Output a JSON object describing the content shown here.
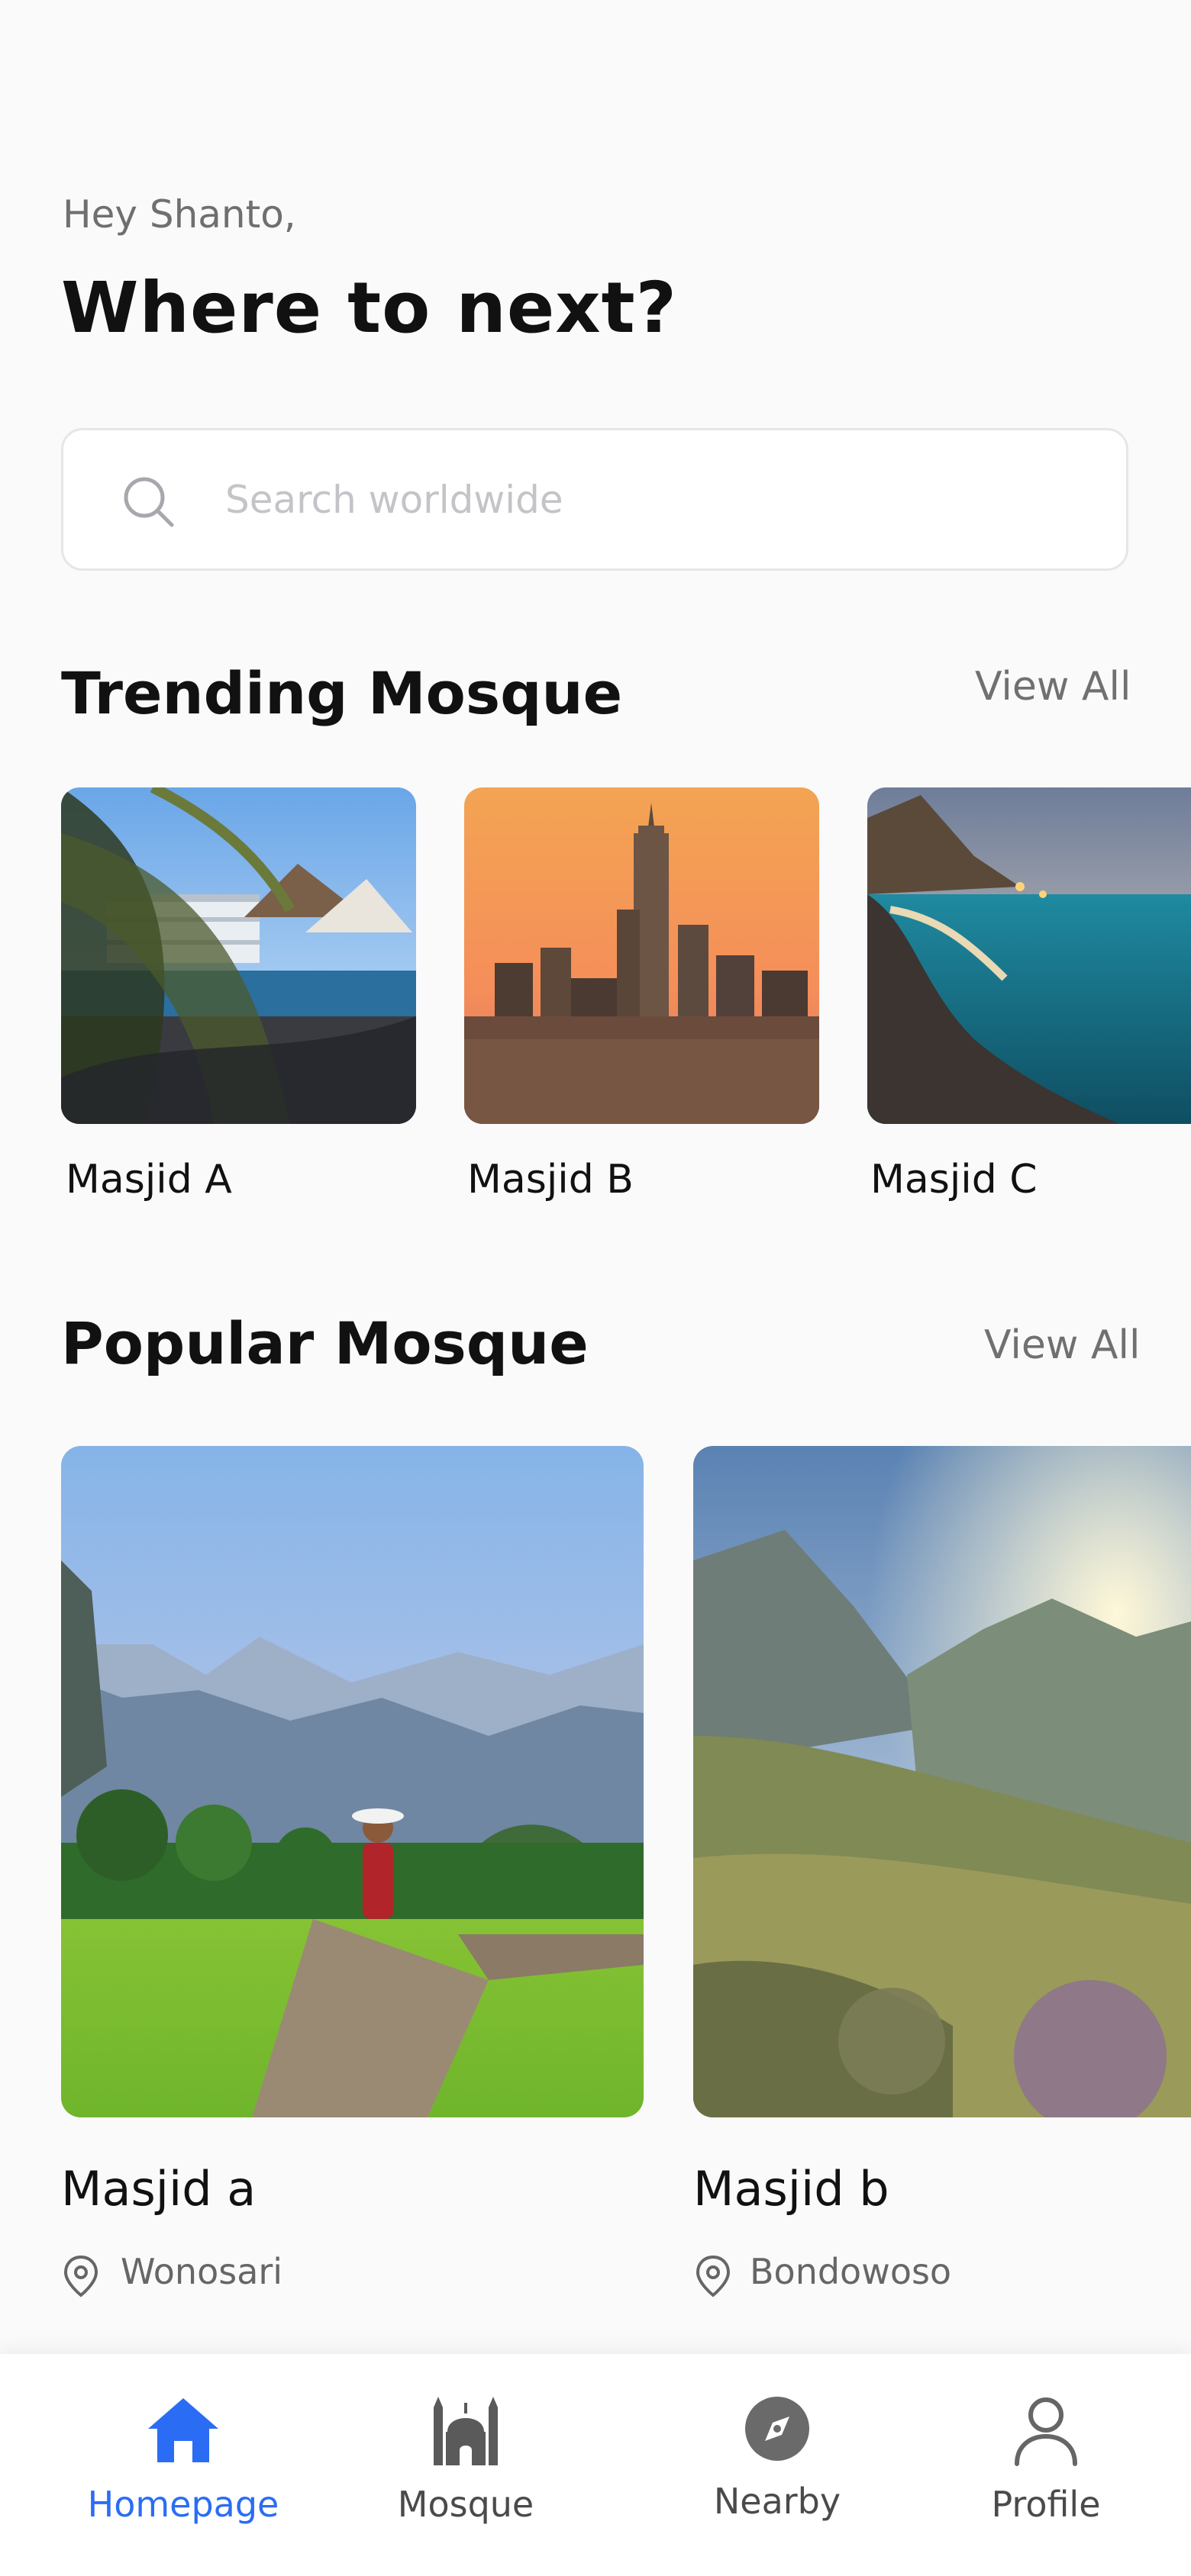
{
  "header": {
    "greeting": "Hey Shanto,",
    "headline": "Where to next?"
  },
  "search": {
    "placeholder": "Search worldwide",
    "icon": "search-icon"
  },
  "trending": {
    "title": "Trending Mosque",
    "view_all": "View All",
    "items": [
      {
        "name": "Masjid A",
        "image": "tropical-resort-photo"
      },
      {
        "name": "Masjid B",
        "image": "city-skyline-sunset-photo"
      },
      {
        "name": "Masjid C",
        "image": "coastal-bay-night-photo"
      }
    ]
  },
  "popular": {
    "title": "Popular Mosque",
    "view_all": "View All",
    "items": [
      {
        "name": "Masjid a",
        "location": "Wonosari",
        "image": "rice-field-mountains-photo"
      },
      {
        "name": "Masjid b",
        "location": "Bondowoso",
        "image": "sunny-valley-mountains-photo"
      }
    ]
  },
  "nav": {
    "items": [
      {
        "label": "Homepage",
        "icon": "home-icon",
        "active": true
      },
      {
        "label": "Mosque",
        "icon": "mosque-icon",
        "active": false
      },
      {
        "label": "Nearby",
        "icon": "compass-icon",
        "active": false
      },
      {
        "label": "Profile",
        "icon": "person-icon",
        "active": false
      }
    ]
  },
  "colors": {
    "background": "#fafafb",
    "accent": "#2a6df4",
    "text": "#111111",
    "muted": "#707070"
  }
}
